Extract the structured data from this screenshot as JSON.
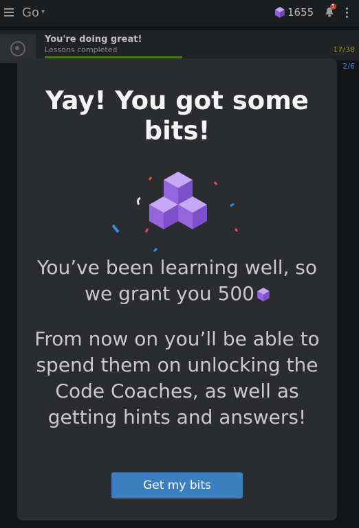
{
  "header": {
    "title": "Go",
    "bits_count": "1655",
    "notification_count": "5",
    "icons": [
      "menu-icon",
      "chevron-down-icon",
      "bits-cube-icon",
      "bell-icon",
      "more-vert-icon"
    ]
  },
  "progress": {
    "title": "You're doing great!",
    "subtitle": "Lessons completed",
    "count": "17/38",
    "count_secondary": "2/6",
    "fraction": 0.447
  },
  "modal": {
    "title": "Yay! You got some bits!",
    "message_line": "You’ve been learning well, so we grant you",
    "amount": "500",
    "description": "From now on you’ll be able to spend them on unlocking the Code Coaches, as well as getting hints and answers!",
    "button_label": "Get my bits"
  },
  "colors": {
    "accent": "#3b7fc0",
    "cube": "#a073e6",
    "modal_bg": "#2b2c2f",
    "page_bg": "#141516"
  }
}
